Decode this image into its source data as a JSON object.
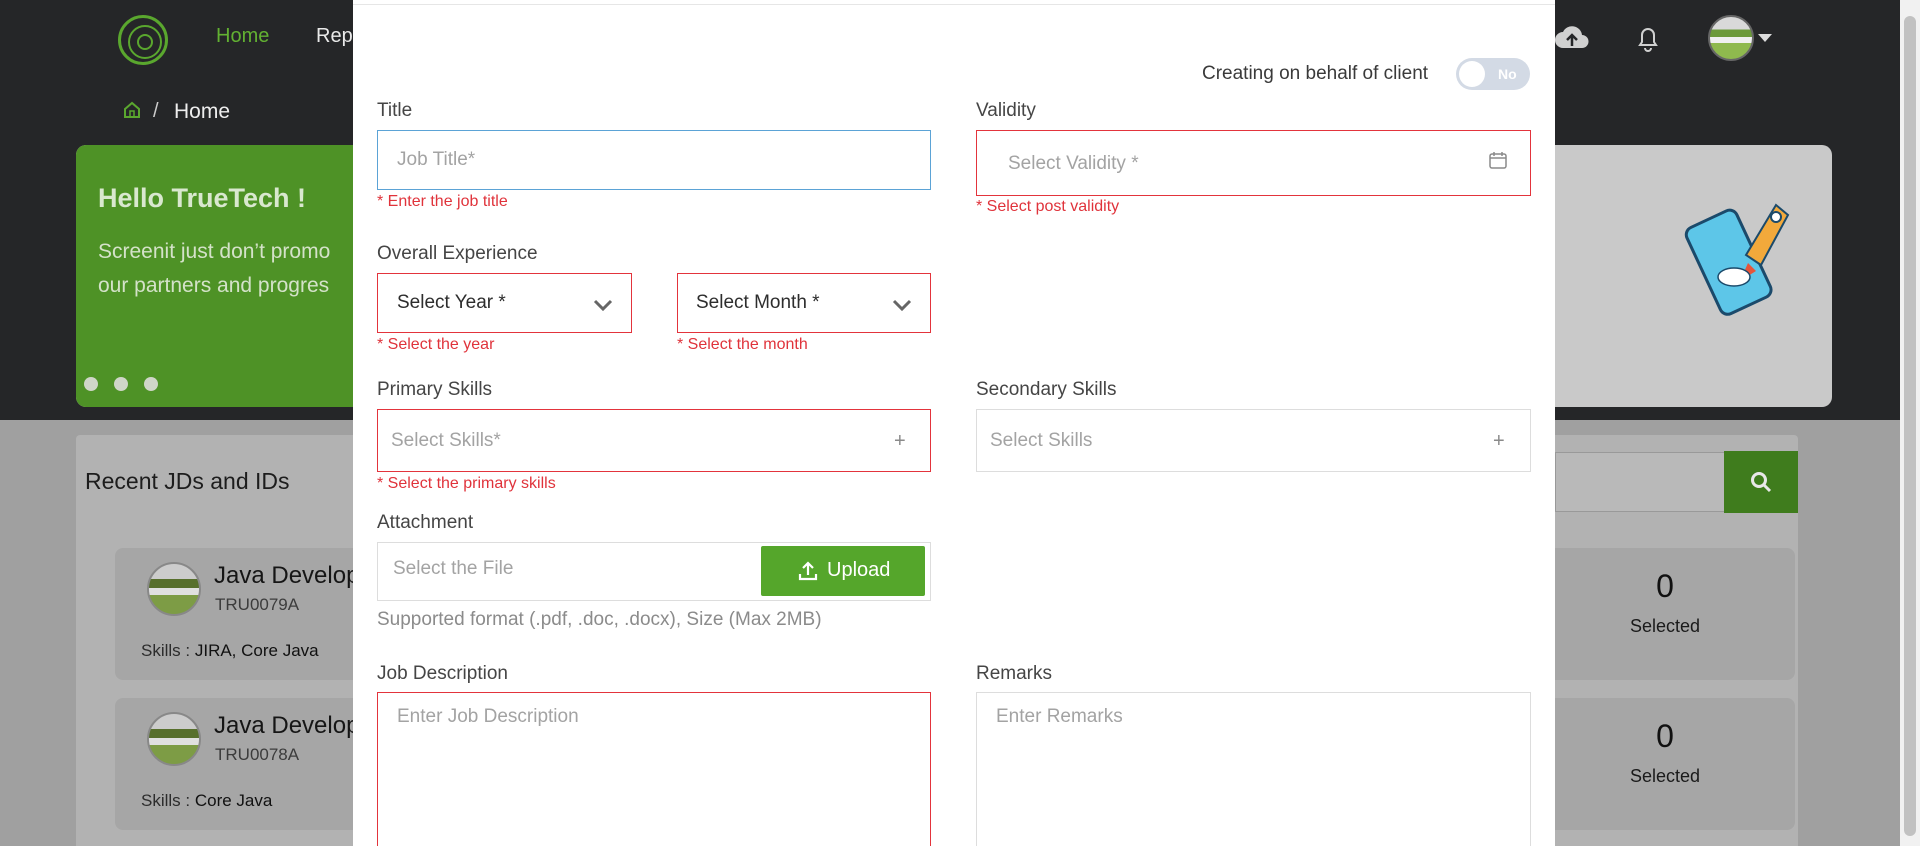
{
  "nav": {
    "home": "Home",
    "reports_partial": "Rep"
  },
  "breadcrumb": {
    "current": "Home",
    "separator": "/"
  },
  "banner": {
    "title": "Hello TrueTech !",
    "line1": "Screenit just don’t promo",
    "line2": "our partners and progres"
  },
  "recent": {
    "title": "Recent JDs and IDs",
    "cards": [
      {
        "title": "Java Develop",
        "id": "TRU0079A",
        "skills_label": "Skills : ",
        "skills": "JIRA, Core Java",
        "count": "0",
        "count_label": "Selected"
      },
      {
        "title": "Java Develop",
        "id": "TRU0078A",
        "skills_label": "Skills : ",
        "skills": "Core Java",
        "count": "0",
        "count_label": "Selected"
      }
    ]
  },
  "modal": {
    "toggle": {
      "label": "Creating on behalf of client",
      "state": "No"
    },
    "title_field": {
      "label": "Title",
      "placeholder": "Job Title*",
      "error": "* Enter the job title"
    },
    "validity_field": {
      "label": "Validity",
      "placeholder": "Select Validity *",
      "error": "* Select post validity"
    },
    "experience": {
      "label": "Overall Experience",
      "year": {
        "value": "Select Year *",
        "error": "* Select the year"
      },
      "month": {
        "value": "Select Month *",
        "error": "* Select the month"
      }
    },
    "primary_skills": {
      "label": "Primary Skills",
      "placeholder": "Select Skills*",
      "error": "* Select the primary skills",
      "add": "+"
    },
    "secondary_skills": {
      "label": "Secondary Skills",
      "placeholder": "Select Skills",
      "add": "+"
    },
    "attachment": {
      "label": "Attachment",
      "placeholder": "Select the File",
      "button": "Upload",
      "hint": "Supported format (.pdf, .doc, .docx), Size (Max 2MB)"
    },
    "job_description": {
      "label": "Job Description",
      "placeholder": "Enter Job Description"
    },
    "remarks": {
      "label": "Remarks",
      "placeholder": "Enter Remarks"
    }
  },
  "colors": {
    "accent_green": "#55a62b",
    "error_red": "#e3343c",
    "focus_blue": "#5ba3d6",
    "nav_bg": "#252628"
  },
  "icons": [
    "logo-icon",
    "cloud-upload-icon",
    "bell-icon",
    "home-icon",
    "search-icon",
    "calendar-icon",
    "chevron-down-icon",
    "plus-icon",
    "upload-icon"
  ]
}
